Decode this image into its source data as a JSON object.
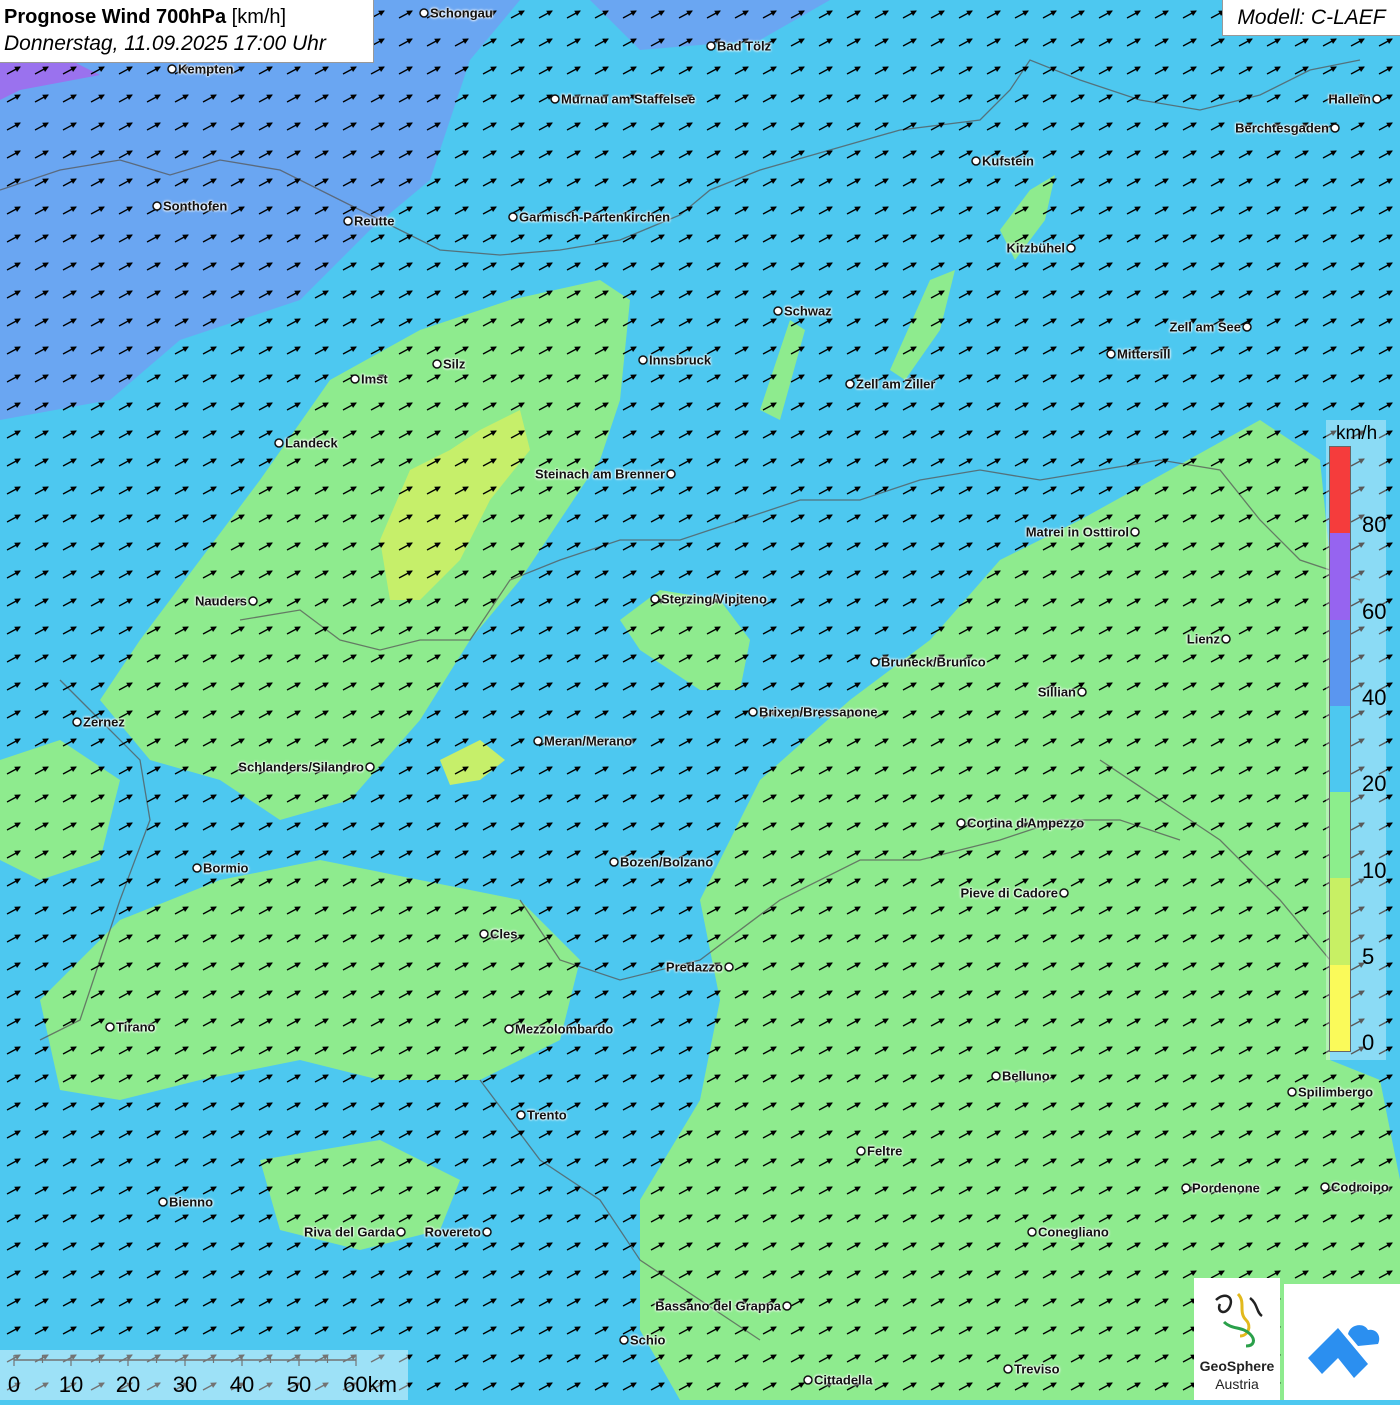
{
  "header": {
    "title_bold": "Prognose Wind 700hPa",
    "title_unit": " [km/h]",
    "subtitle": "Donnerstag, 11.09.2025 17:00 Uhr"
  },
  "model_label": "Modell: C-LAEF",
  "legend": {
    "unit": "km/h",
    "ticks": [
      "0",
      "5",
      "10",
      "20",
      "40",
      "60",
      "80"
    ],
    "colors": [
      "#fafa5a",
      "#c8f064",
      "#8cee8c",
      "#4dc8f0",
      "#5a96f0",
      "#9664f0",
      "#f53c3c"
    ]
  },
  "scale_bar": {
    "labels": [
      "0",
      "10",
      "20",
      "30",
      "40",
      "50",
      "60km"
    ]
  },
  "logos": {
    "geosphere_name": "GeoSphere",
    "geosphere_sub": "Austria"
  },
  "wind_direction": "south-west to north-east",
  "cities": [
    {
      "name": "Schongau"
    },
    {
      "name": "Bad Tölz"
    },
    {
      "name": "Kempten"
    },
    {
      "name": "Murnau am Staffelsee"
    },
    {
      "name": "Hallein"
    },
    {
      "name": "Berchtesgaden"
    },
    {
      "name": "Kufstein"
    },
    {
      "name": "Sonthofen"
    },
    {
      "name": "Reutte"
    },
    {
      "name": "Garmisch-Partenkirchen"
    },
    {
      "name": "Kitzbühel"
    },
    {
      "name": "Schwaz"
    },
    {
      "name": "Zell am See"
    },
    {
      "name": "Silz"
    },
    {
      "name": "Innsbruck"
    },
    {
      "name": "Mittersill"
    },
    {
      "name": "Imst"
    },
    {
      "name": "Zell am Ziller"
    },
    {
      "name": "Landeck"
    },
    {
      "name": "Steinach am Brenner"
    },
    {
      "name": "Matrei in Osttirol"
    },
    {
      "name": "Nauders"
    },
    {
      "name": "Sterzing/Vipiteno"
    },
    {
      "name": "Lienz"
    },
    {
      "name": "Bruneck/Brunico"
    },
    {
      "name": "Sillian"
    },
    {
      "name": "Brixen/Bressanone"
    },
    {
      "name": "Zernez"
    },
    {
      "name": "Meran/Merano"
    },
    {
      "name": "Schlanders/Silandro"
    },
    {
      "name": "Cortina d'Ampezzo"
    },
    {
      "name": "Bozen/Bolzano"
    },
    {
      "name": "Bormio"
    },
    {
      "name": "Pieve di Cadore"
    },
    {
      "name": "Cles"
    },
    {
      "name": "Predazzo"
    },
    {
      "name": "Tirano"
    },
    {
      "name": "Mezzolombardo"
    },
    {
      "name": "Belluno"
    },
    {
      "name": "Spilimbergo"
    },
    {
      "name": "Trento"
    },
    {
      "name": "Feltre"
    },
    {
      "name": "Pordenone"
    },
    {
      "name": "Codroipo"
    },
    {
      "name": "Bienno"
    },
    {
      "name": "Riva del Garda"
    },
    {
      "name": "Rovereto"
    },
    {
      "name": "Conegliano"
    },
    {
      "name": "Bassano del Grappa"
    },
    {
      "name": "Schio"
    },
    {
      "name": "Treviso"
    },
    {
      "name": "Cittadella"
    }
  ]
}
